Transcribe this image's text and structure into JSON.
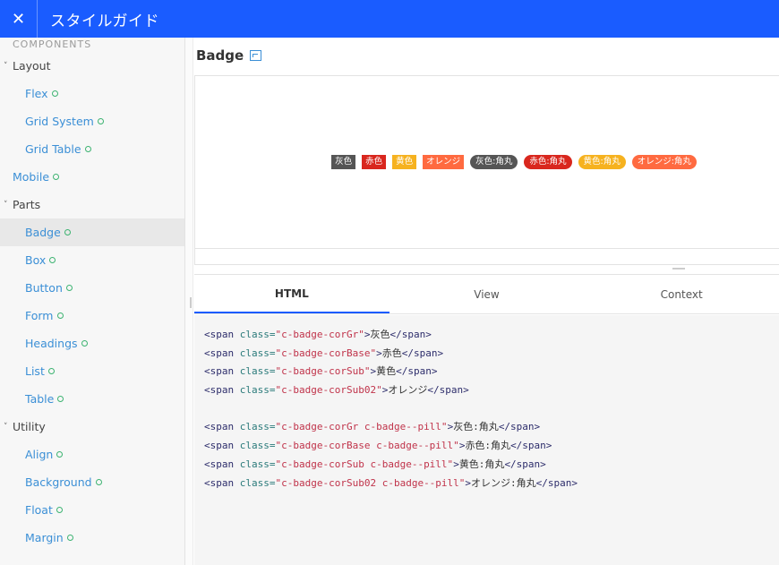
{
  "header": {
    "close_icon": "close-icon",
    "title": "スタイルガイド"
  },
  "sidebar": {
    "heading": "COMPONENTS",
    "items": [
      {
        "kind": "group",
        "label": "Layout"
      },
      {
        "kind": "link",
        "label": "Flex"
      },
      {
        "kind": "link",
        "label": "Grid System"
      },
      {
        "kind": "link",
        "label": "Grid Table"
      },
      {
        "kind": "top",
        "label": "Mobile"
      },
      {
        "kind": "group",
        "label": "Parts"
      },
      {
        "kind": "link",
        "label": "Badge",
        "active": true
      },
      {
        "kind": "link",
        "label": "Box"
      },
      {
        "kind": "link",
        "label": "Button"
      },
      {
        "kind": "link",
        "label": "Form"
      },
      {
        "kind": "link",
        "label": "Headings"
      },
      {
        "kind": "link",
        "label": "List"
      },
      {
        "kind": "link",
        "label": "Table"
      },
      {
        "kind": "group",
        "label": "Utility"
      },
      {
        "kind": "link",
        "label": "Align"
      },
      {
        "kind": "link",
        "label": "Background"
      },
      {
        "kind": "link",
        "label": "Float"
      },
      {
        "kind": "link",
        "label": "Margin"
      }
    ]
  },
  "main": {
    "title": "Badge",
    "badges": [
      {
        "label": "灰色",
        "cls": "b-gr"
      },
      {
        "label": "赤色",
        "cls": "b-base"
      },
      {
        "label": "黄色",
        "cls": "b-sub"
      },
      {
        "label": "オレンジ",
        "cls": "b-sub02"
      },
      {
        "label": "灰色:角丸",
        "cls": "b-gr pill"
      },
      {
        "label": "赤色:角丸",
        "cls": "b-base pill"
      },
      {
        "label": "黄色:角丸",
        "cls": "b-sub pill"
      },
      {
        "label": "オレンジ:角丸",
        "cls": "b-sub02 pill"
      }
    ],
    "tabs": [
      {
        "label": "HTML",
        "active": true
      },
      {
        "label": "View"
      },
      {
        "label": "Context"
      }
    ],
    "code_lines": [
      {
        "cls": "c-badge-corGr",
        "text": "灰色"
      },
      {
        "cls": "c-badge-corBase",
        "text": "赤色"
      },
      {
        "cls": "c-badge-corSub",
        "text": "黄色"
      },
      {
        "cls": "c-badge-corSub02",
        "text": "オレンジ"
      },
      null,
      {
        "cls": "c-badge-corGr c-badge--pill",
        "text": "灰色:角丸"
      },
      {
        "cls": "c-badge-corBase c-badge--pill",
        "text": "赤色:角丸"
      },
      {
        "cls": "c-badge-corSub c-badge--pill",
        "text": "黄色:角丸"
      },
      {
        "cls": "c-badge-corSub02 c-badge--pill",
        "text": "オレンジ:角丸"
      }
    ]
  },
  "colors": {
    "brand": "#1a5cff",
    "link": "#3b8fd6",
    "gray": "#555555",
    "red": "#d9271e",
    "yellow": "#f6b21f",
    "orange": "#ff6a40"
  }
}
